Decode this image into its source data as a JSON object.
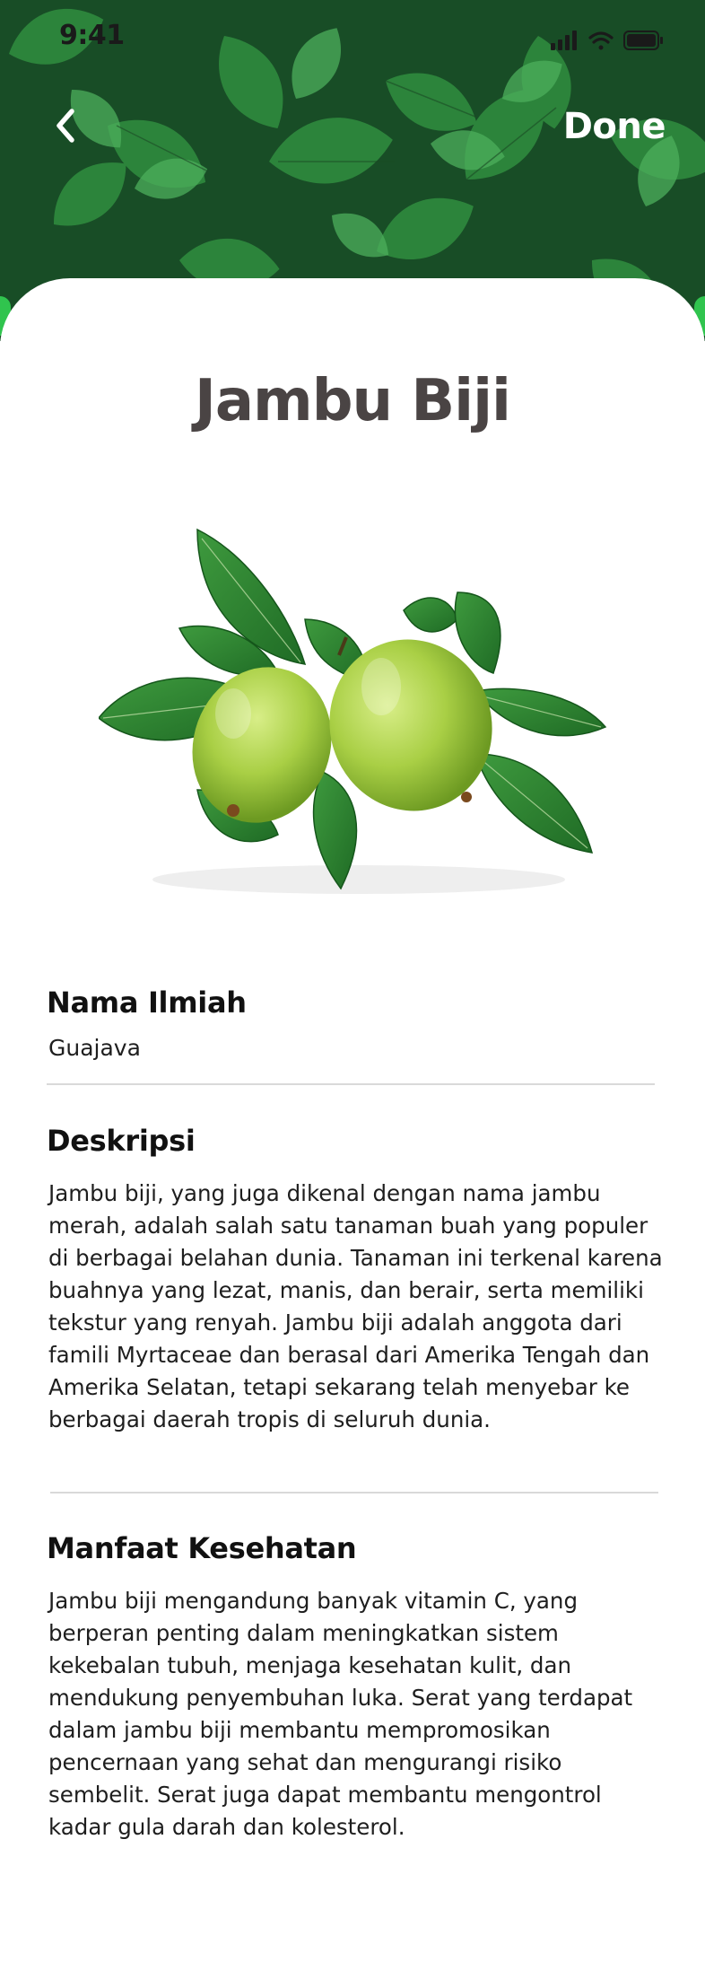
{
  "status_bar": {
    "time": "9:41",
    "icons": [
      "signal-icon",
      "wifi-icon",
      "battery-icon"
    ]
  },
  "header": {
    "back_icon": "chevron-left-icon",
    "done_label": "Done"
  },
  "plant": {
    "name": "Jambu Biji"
  },
  "sections": {
    "nama_ilmiah": {
      "heading": "Nama Ilmiah",
      "value": "Guajava"
    },
    "deskripsi": {
      "heading": "Deskripsi",
      "text": "Jambu biji, yang juga dikenal dengan nama jambu merah, adalah salah satu tanaman buah yang populer di berbagai belahan dunia. Tanaman ini terkenal karena buahnya yang lezat, manis, dan berair, serta memiliki tekstur yang renyah. Jambu biji adalah anggota dari famili Myrtaceae dan berasal dari Amerika Tengah dan Amerika Selatan, tetapi sekarang telah menyebar ke berbagai daerah tropis di seluruh dunia."
    },
    "manfaat": {
      "heading": "Manfaat Kesehatan",
      "text": "Jambu biji mengandung banyak vitamin C, yang berperan penting dalam meningkatkan sistem kekebalan tubuh, menjaga kesehatan kulit, dan mendukung penyembuhan luka. Serat yang terdapat dalam jambu biji membantu mempromosikan pencernaan yang sehat dan mengurangi risiko sembelit. Serat juga dapat membantu mengontrol kadar gula darah dan kolesterol."
    }
  },
  "colors": {
    "hero_green": "#1d5a2c",
    "accent_green": "#30c44e",
    "title_text": "#4a4444"
  }
}
